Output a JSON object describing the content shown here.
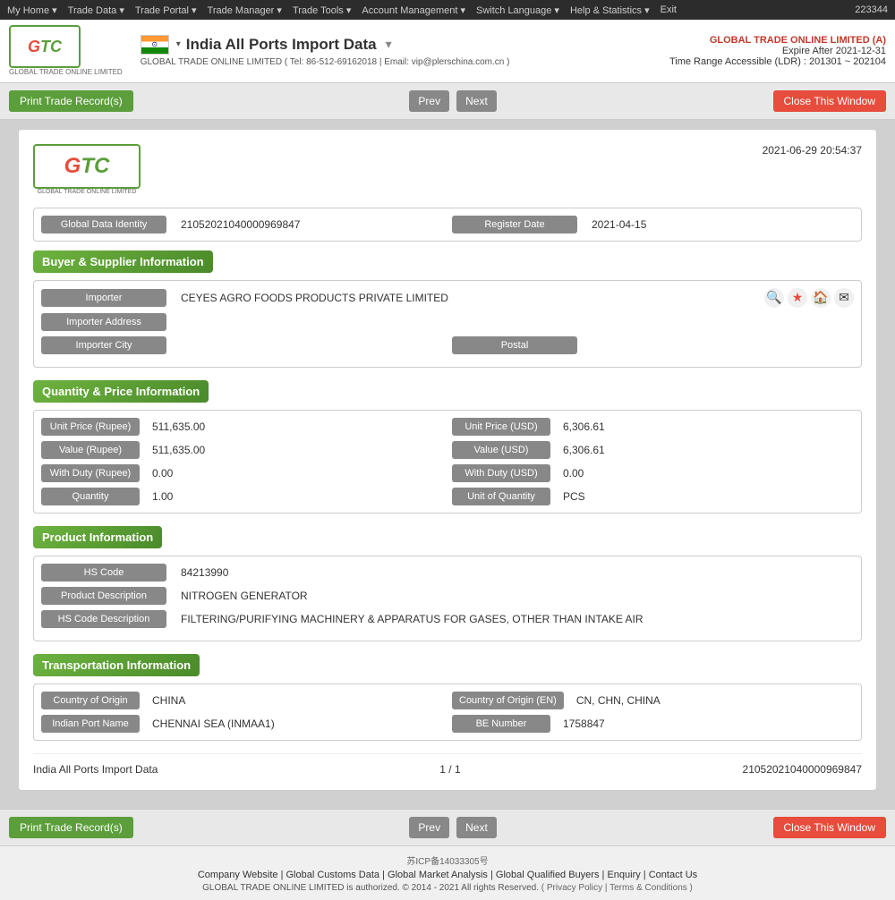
{
  "topbar": {
    "id": "223344",
    "nav": [
      "My Home ▾",
      "Trade Data ▾",
      "Trade Portal ▾",
      "Trade Manager ▾",
      "Trade Tools ▾",
      "Account Management ▾",
      "Switch Language ▾",
      "Help & Statistics ▾",
      "Exit"
    ]
  },
  "header": {
    "logo_text": "GTC",
    "logo_sub": "GLOBAL TRADE ONLINE LIMITED",
    "page_title": "India All Ports Import Data",
    "dropdown_arrow": "▾",
    "subtext": "GLOBAL TRADE ONLINE LIMITED ( Tel: 86-512-69162018 | Email: vip@plerschina.com.cn )",
    "company_name": "GLOBAL TRADE ONLINE LIMITED (A)",
    "expire": "Expire After 2021-12-31",
    "range": "Time Range Accessible (LDR) : 201301 ~ 202104"
  },
  "toolbar": {
    "print_button": "Print Trade Record(s)",
    "prev_button": "Prev",
    "next_button": "Next",
    "close_button": "Close This Window"
  },
  "record": {
    "date": "2021-06-29 20:54:37",
    "global_data_identity_label": "Global Data Identity",
    "global_data_identity_value": "21052021040000969847",
    "register_date_label": "Register Date",
    "register_date_value": "2021-04-15",
    "sections": {
      "buyer_supplier": {
        "title": "Buyer & Supplier Information",
        "importer_label": "Importer",
        "importer_value": "CEYES AGRO FOODS PRODUCTS PRIVATE LIMITED",
        "importer_address_label": "Importer Address",
        "importer_address_value": "",
        "importer_city_label": "Importer City",
        "importer_city_value": "",
        "postal_label": "Postal",
        "postal_value": ""
      },
      "quantity_price": {
        "title": "Quantity & Price Information",
        "unit_price_rupee_label": "Unit Price (Rupee)",
        "unit_price_rupee_value": "511,635.00",
        "unit_price_usd_label": "Unit Price (USD)",
        "unit_price_usd_value": "6,306.61",
        "value_rupee_label": "Value (Rupee)",
        "value_rupee_value": "511,635.00",
        "value_usd_label": "Value (USD)",
        "value_usd_value": "6,306.61",
        "with_duty_rupee_label": "With Duty (Rupee)",
        "with_duty_rupee_value": "0.00",
        "with_duty_usd_label": "With Duty (USD)",
        "with_duty_usd_value": "0.00",
        "quantity_label": "Quantity",
        "quantity_value": "1.00",
        "unit_of_quantity_label": "Unit of Quantity",
        "unit_of_quantity_value": "PCS"
      },
      "product": {
        "title": "Product Information",
        "hs_code_label": "HS Code",
        "hs_code_value": "84213990",
        "product_desc_label": "Product Description",
        "product_desc_value": "NITROGEN GENERATOR",
        "hs_code_desc_label": "HS Code Description",
        "hs_code_desc_value": "FILTERING/PURIFYING MACHINERY & APPARATUS FOR GASES, OTHER THAN INTAKE AIR"
      },
      "transportation": {
        "title": "Transportation Information",
        "country_origin_label": "Country of Origin",
        "country_origin_value": "CHINA",
        "country_origin_en_label": "Country of Origin (EN)",
        "country_origin_en_value": "CN, CHN, CHINA",
        "indian_port_label": "Indian Port Name",
        "indian_port_value": "CHENNAI SEA (INMAA1)",
        "be_number_label": "BE Number",
        "be_number_value": "1758847"
      }
    },
    "footer": {
      "left": "India All Ports Import Data",
      "center": "1 / 1",
      "right": "21052021040000969847"
    }
  },
  "bottom_toolbar": {
    "print_button": "Print Trade Record(s)",
    "prev_button": "Prev",
    "next_button": "Next",
    "close_button": "Close This Window"
  },
  "footer": {
    "icp": "苏ICP备14033305号",
    "links": [
      "Company Website",
      "Global Customs Data",
      "Global Market Analysis",
      "Global Qualified Buyers",
      "Enquiry",
      "Contact Us"
    ],
    "copyright": "GLOBAL TRADE ONLINE LIMITED is authorized. © 2014 - 2021 All rights Reserved.",
    "policy": "( Privacy Policy | Terms & Conditions )"
  }
}
